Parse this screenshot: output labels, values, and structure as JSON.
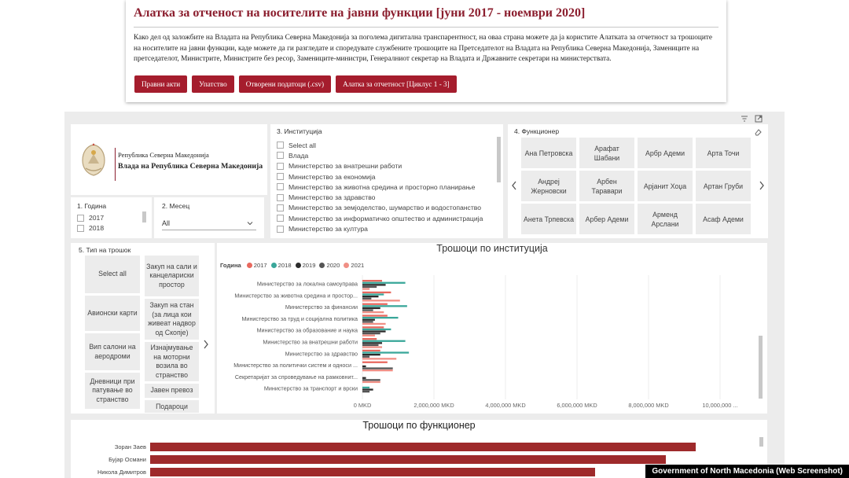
{
  "header": {
    "title": "Алатка за отченост на носителите на јавни функции [јуни 2017 - ноември 2020]",
    "description": "Како дел од заложбите на Владата на Република Северна Македонија за поголема дигитална транспарентност, на оваа страна можете да ја користите Алатката за отчетност за трошоците на носителите на јавни функции, каде можете да ги разгледате и споредувате службените трошоците на Претседателот на Владата на Република Северна Македонија, Замениците на претседателот, Министрите, Министрите без ресор, Замениците-министри, Генералниот секретар на Владата и Државните секретари на министерствата.",
    "buttons": [
      "Правни акти",
      "Упатство",
      "Отворени податоци (.csv)",
      "Алатка за отчетност [Циклус 1 - 3]"
    ]
  },
  "logo": {
    "line1": "Република Северна Македонија",
    "line2": "Влада на Република Северна Македонија",
    "crest_icon": "coat-of-arms-icon"
  },
  "filters": {
    "year": {
      "title": "1. Година",
      "options": [
        "2017",
        "2018"
      ]
    },
    "month": {
      "title": "2. Месец",
      "value": "All"
    },
    "institution": {
      "title": "3. Институција",
      "options": [
        "Select all",
        "Влада",
        "Министерство за внатрешни работи",
        "Министерство за економија",
        "Министерство за животна средина и просторно планирање",
        "Министерство за здравство",
        "Министерство за земјоделство, шумарство и водостопанство",
        "Министерство за информатичко општество и администрација",
        "Министерство за култура"
      ]
    },
    "official": {
      "title": "4. Функционер",
      "names": [
        "Ана Петровска",
        "Арафат Шабани",
        "Арбр Адеми",
        "Арта Точи",
        "Андреј Жерновски",
        "Арбен Таравари",
        "Арјанит Хоџа",
        "Артан Груби",
        "Анета Трпевска",
        "Арбер Адеми",
        "Арменд Арслани",
        "Асаф Адеми"
      ]
    },
    "cost_type": {
      "title": "5. Тип на трошок",
      "left": [
        "Select all",
        "Авионски карти",
        "Вип салони на аеродроми",
        "Дневници при патување во странство"
      ],
      "right": [
        "Закуп на сали и канцелариски простор",
        "Закуп на стан (за лица кои живеат надвор од Скопје)",
        "Изнајмување на моторни возила во странство",
        "Јавен превоз",
        "Подароци подарени на"
      ]
    }
  },
  "chart_data": [
    {
      "type": "bar",
      "orientation": "horizontal",
      "title": "Трошоци по институција",
      "legend_title": "Година",
      "legend_placement": "top-left",
      "categories": [
        "Министерство за локална самоуправа",
        "Министерство за животна средина и простор...",
        "Министерство за финансии",
        "Министерство за труд и социјална политика",
        "Министерство за образование и наука",
        "Министерство за внатрешни работи",
        "Министерство за здравство",
        "Министерство за политички систем и односи ...",
        "Секретаријат за спроведување на рамковнит...",
        "Министерство за транспорт и врски"
      ],
      "series": [
        {
          "name": "2017",
          "color": "#e8685e",
          "values": [
            550000,
            800000,
            700000,
            700000,
            600000,
            400000,
            500000,
            700000,
            0,
            0
          ]
        },
        {
          "name": "2018",
          "color": "#3aa79a",
          "values": [
            1200000,
            600000,
            1250000,
            1000000,
            800000,
            1200000,
            1300000,
            0,
            0,
            200000
          ]
        },
        {
          "name": "2019",
          "color": "#2b2b2b",
          "values": [
            650000,
            450000,
            500000,
            350000,
            650000,
            550000,
            500000,
            100000,
            100000,
            300000
          ]
        },
        {
          "name": "2020",
          "color": "#555555",
          "values": [
            400000,
            250000,
            300000,
            300000,
            500000,
            450000,
            200000,
            850000,
            500000,
            200000
          ]
        },
        {
          "name": "2021",
          "color": "#f08f85",
          "values": [
            200000,
            1050000,
            600000,
            650000,
            350000,
            550000,
            950000,
            850000,
            500000,
            0
          ]
        }
      ],
      "x_ticks": [
        "0 MKD",
        "2,000,000 MKD",
        "4,000,000 MKD",
        "6,000,000 MKD",
        "8,000,000 MKD",
        "10,000,000 ..."
      ],
      "xlim": [
        0,
        10000000
      ],
      "grid": true
    },
    {
      "type": "bar",
      "orientation": "horizontal",
      "title": "Трошоци по функционер",
      "categories": [
        "Зоран Заев",
        "Бујар Османи",
        "Никола Димитров"
      ],
      "series": [
        {
          "color": "#9e2a2b",
          "values": [
            1.0,
            0.945,
            0.815
          ]
        }
      ]
    }
  ],
  "watermark": "Government of North Macedonia (Web Screenshot)"
}
